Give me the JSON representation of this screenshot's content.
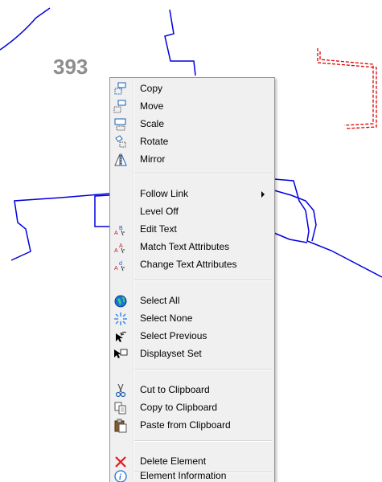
{
  "parcel_label": "393",
  "colors": {
    "boundary_line": "#0000e0",
    "dashed_parcel": "#e00000",
    "menu_background": "#f0f0f0"
  },
  "menu": {
    "items": [
      {
        "label": "Copy",
        "icon": "copy-icon"
      },
      {
        "label": "Move",
        "icon": "move-icon"
      },
      {
        "label": "Scale",
        "icon": "scale-icon"
      },
      {
        "label": "Rotate",
        "icon": "rotate-icon"
      },
      {
        "label": "Mirror",
        "icon": "mirror-icon"
      },
      {
        "label": "Follow Link",
        "icon": "none",
        "submenu": true
      },
      {
        "label": "Level Off",
        "icon": "none"
      },
      {
        "label": "Edit Text",
        "icon": "edit-text-icon"
      },
      {
        "label": "Match Text Attributes",
        "icon": "match-text-attributes-icon"
      },
      {
        "label": "Change Text Attributes",
        "icon": "change-text-attributes-icon"
      },
      {
        "label": "Select All",
        "icon": "select-all-icon"
      },
      {
        "label": "Select None",
        "icon": "select-none-icon"
      },
      {
        "label": "Select Previous",
        "icon": "select-previous-icon"
      },
      {
        "label": "Displayset Set",
        "icon": "displayset-set-icon"
      },
      {
        "label": "Cut to Clipboard",
        "icon": "scissors-icon"
      },
      {
        "label": "Copy to Clipboard",
        "icon": "copy-clipboard-icon"
      },
      {
        "label": "Paste from Clipboard",
        "icon": "paste-clipboard-icon"
      },
      {
        "label": "Delete Element",
        "icon": "delete-x-icon"
      },
      {
        "label": "Element Information",
        "icon": "info-icon"
      }
    ]
  }
}
